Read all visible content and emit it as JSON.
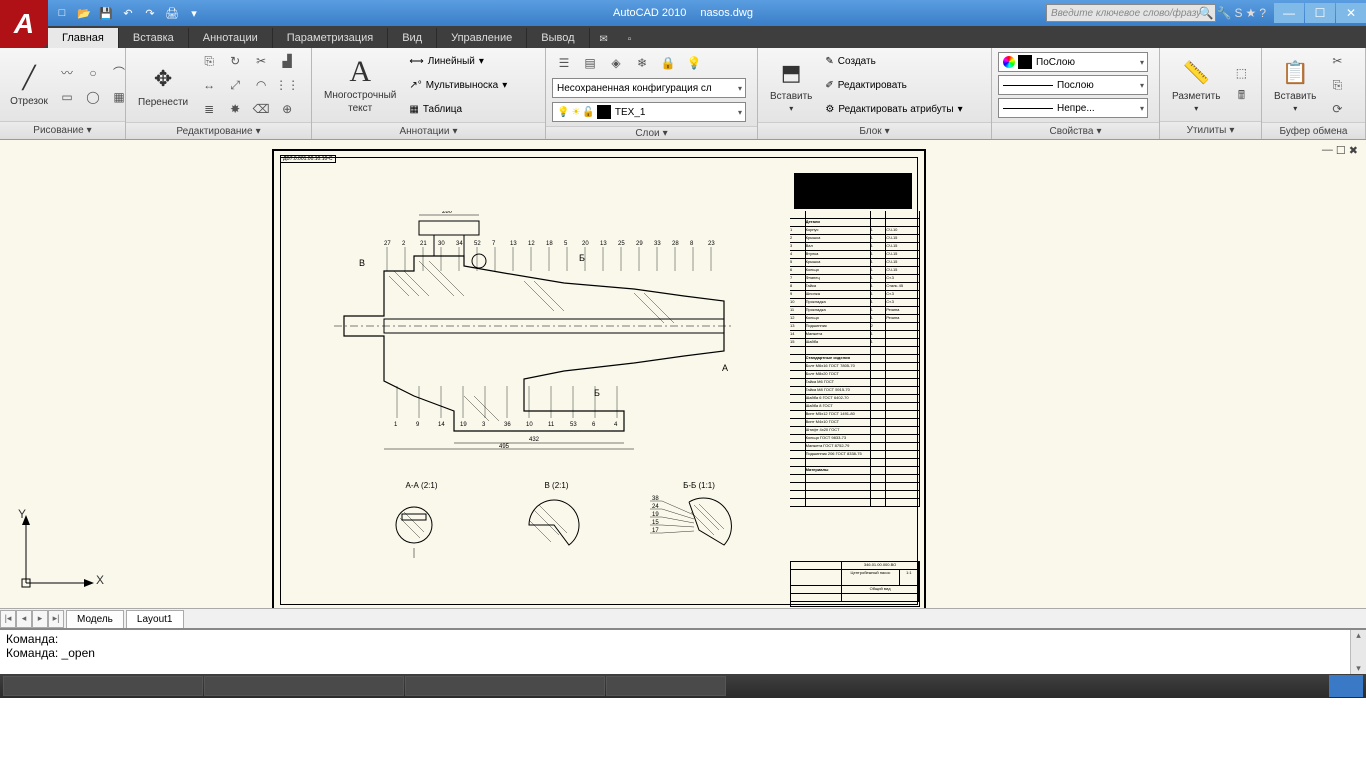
{
  "title": {
    "app": "AutoCAD 2010",
    "file": "nasos.dwg"
  },
  "search_placeholder": "Введите ключевое слово/фразу",
  "tabs": [
    "Главная",
    "Вставка",
    "Аннотации",
    "Параметризация",
    "Вид",
    "Управление",
    "Вывод"
  ],
  "active_tab": 0,
  "panels": {
    "draw": {
      "title": "Рисование",
      "big": "Отрезок"
    },
    "modify": {
      "title": "Редактирование",
      "big": "Перенести"
    },
    "annot": {
      "title": "Аннотации",
      "big_line1": "Многострочный",
      "big_line2": "текст",
      "items": [
        "Линейный",
        "Мультивыноска",
        "Таблица"
      ]
    },
    "layers": {
      "title": "Слои",
      "combo1": "Несохраненная конфигурация сл",
      "combo2": "TEX_1"
    },
    "block": {
      "title": "Блок",
      "big": "Вставить",
      "items": [
        "Создать",
        "Редактировать",
        "Редактировать атрибуты"
      ]
    },
    "props": {
      "title": "Свойства",
      "color": "ПоСлою",
      "lw": "Послою",
      "lt": "Непре..."
    },
    "utils": {
      "title": "Утилиты",
      "big": "Разметить"
    },
    "clip": {
      "title": "Буфер обмена",
      "big": "Вставить"
    }
  },
  "model_tabs": [
    "Модель",
    "Layout1"
  ],
  "command_lines": [
    "Команда:",
    "Команда: _open"
  ],
  "drawing": {
    "frame_tag": "ДВ7.0.001.00.10.10-С",
    "main_dims": [
      "280",
      "432",
      "495"
    ],
    "main_labels": [
      "В",
      "Б",
      "Б",
      "А"
    ],
    "balloons_top": [
      "27",
      "2",
      "21",
      "30",
      "34",
      "52",
      "7",
      "13",
      "12",
      "18",
      "5",
      "20",
      "13",
      "25",
      "29",
      "33",
      "28",
      "8",
      "23"
    ],
    "balloons_bot": [
      "1",
      "9",
      "14",
      "19",
      "3",
      "36",
      "10",
      "11",
      "53",
      "6",
      "4"
    ],
    "details": [
      {
        "label": "А-А (2:1)"
      },
      {
        "label": "В (2:1)"
      },
      {
        "label": "Б-Б (1:1)",
        "nums": [
          "38",
          "24",
          "19",
          "15",
          "17"
        ]
      }
    ],
    "bom_header": [
      "Детали"
    ],
    "bom_rows": [
      [
        "1",
        "Корпус",
        "1",
        "СЧ-10"
      ],
      [
        "2",
        "Крышка",
        "1",
        "СЧ-15"
      ],
      [
        "3",
        "Вал",
        "1",
        "СЧ-15"
      ],
      [
        "4",
        "Втулка",
        "1",
        "СЧ-15"
      ],
      [
        "5",
        "Крышка",
        "1",
        "СЧ-15"
      ],
      [
        "6",
        "Кольцо",
        "1",
        "СЧ-15"
      ],
      [
        "7",
        "Фланец",
        "1",
        "Ст.3"
      ],
      [
        "8",
        "Гайка",
        "1",
        "Сталь 45"
      ],
      [
        "9",
        "Шпонка",
        "1",
        "Ст.3"
      ],
      [
        "10",
        "Прокладка",
        "1",
        "Ст.3"
      ],
      [
        "11",
        "Прокладка",
        "1",
        "Резина"
      ],
      [
        "12",
        "Кольцо",
        "1",
        "Резина"
      ],
      [
        "13",
        "Подшипник",
        "2",
        ""
      ],
      [
        "14",
        "Манжета",
        "1",
        ""
      ],
      [
        "15",
        "Шайба",
        "1",
        ""
      ]
    ],
    "bom_section2": "Стандартные изделия",
    "bom_std": [
      "Болт М6x16 ГОСТ 7805-70",
      "Болт М8x20 ГОСТ",
      "Гайка М6 ГОСТ",
      "Гайка М8 ГОСТ 5915-70",
      "Шайба 6 ГОСТ 6402-70",
      "Шайба 8 ГОСТ",
      "Винт М5x12 ГОСТ 1491-80",
      "Винт М4x10 ГОСТ",
      "Штифт 4x20 ГОСТ",
      "Кольцо ГОСТ 9833-73",
      "Манжета ГОСТ 8752-79",
      "Подшипник 206 ГОСТ 8338-75"
    ],
    "bom_section3": "Материалы",
    "title_block": {
      "code": "346.01.00.000.ВО",
      "name": "Центробежный насос",
      "sub": "Общий вид",
      "scale": "1:1"
    }
  }
}
